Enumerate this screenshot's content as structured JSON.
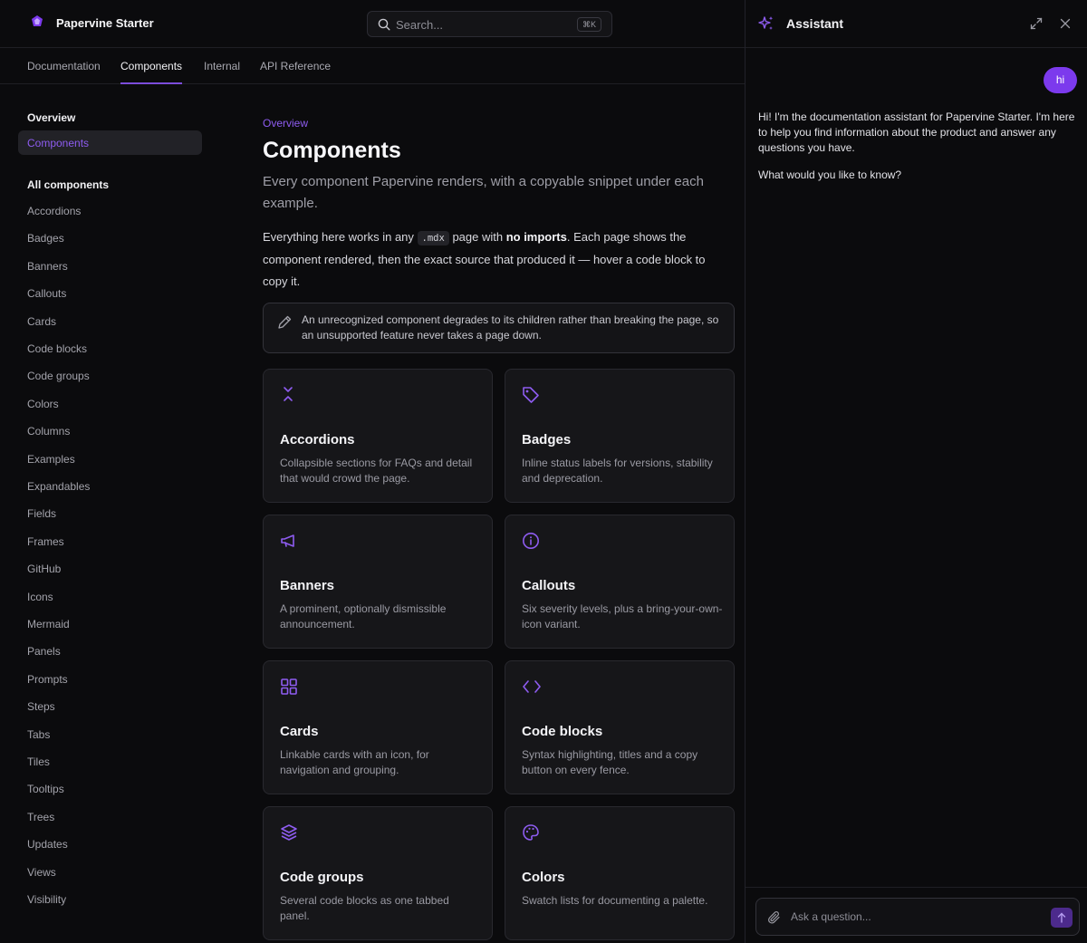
{
  "header": {
    "brand": "Papervine Starter",
    "search_placeholder": "Search...",
    "search_shortcut": "⌘K"
  },
  "tabs": [
    {
      "label": "Documentation",
      "active": false
    },
    {
      "label": "Components",
      "active": true
    },
    {
      "label": "Internal",
      "active": false
    },
    {
      "label": "API Reference",
      "active": false
    }
  ],
  "sidebar": {
    "section_overview": "Overview",
    "active_item": "Components",
    "section_all": "All components",
    "items": [
      "Accordions",
      "Badges",
      "Banners",
      "Callouts",
      "Cards",
      "Code blocks",
      "Code groups",
      "Colors",
      "Columns",
      "Examples",
      "Expandables",
      "Fields",
      "Frames",
      "GitHub",
      "Icons",
      "Mermaid",
      "Panels",
      "Prompts",
      "Steps",
      "Tabs",
      "Tiles",
      "Tooltips",
      "Trees",
      "Updates",
      "Views",
      "Visibility"
    ]
  },
  "main": {
    "eyebrow": "Overview",
    "title": "Components",
    "lead": "Every component Papervine renders, with a copyable snippet under each example.",
    "body_before_code": "Everything here works in any ",
    "body_code": ".mdx",
    "body_mid": " page with ",
    "body_bold": "no imports",
    "body_after": ". Each page shows the component rendered, then the exact source that produced it — hover a code block to copy it.",
    "note": "An unrecognized component degrades to its children rather than breaking the page, so an unsupported feature never takes a page down.",
    "cards": [
      {
        "title": "Accordions",
        "desc": "Collapsible sections for FAQs and detail that would crowd the page.",
        "icon": "chevrons-collapse-icon"
      },
      {
        "title": "Badges",
        "desc": "Inline status labels for versions, stability and deprecation.",
        "icon": "tag-icon"
      },
      {
        "title": "Banners",
        "desc": "A prominent, optionally dismissible announcement.",
        "icon": "megaphone-icon"
      },
      {
        "title": "Callouts",
        "desc": "Six severity levels, plus a bring-your-own-icon variant.",
        "icon": "info-circle-icon"
      },
      {
        "title": "Cards",
        "desc": "Linkable cards with an icon, for navigation and grouping.",
        "icon": "grid-icon"
      },
      {
        "title": "Code blocks",
        "desc": "Syntax highlighting, titles and a copy button on every fence.",
        "icon": "code-icon"
      },
      {
        "title": "Code groups",
        "desc": "Several code blocks as one tabbed panel.",
        "icon": "layers-icon"
      },
      {
        "title": "Colors",
        "desc": "Swatch lists for documenting a palette.",
        "icon": "palette-icon"
      }
    ]
  },
  "assistant": {
    "title": "Assistant",
    "user_message": "hi",
    "reply_1": "Hi! I'm the documentation assistant for Papervine Starter. I'm here to help you find information about the product and answer any questions you have.",
    "reply_2": "What would you like to know?",
    "input_placeholder": "Ask a question..."
  },
  "colors": {
    "accent": "#8e5cf0",
    "accent_button": "#7c3aed",
    "background": "#0b0b0d",
    "card": "#161619"
  }
}
